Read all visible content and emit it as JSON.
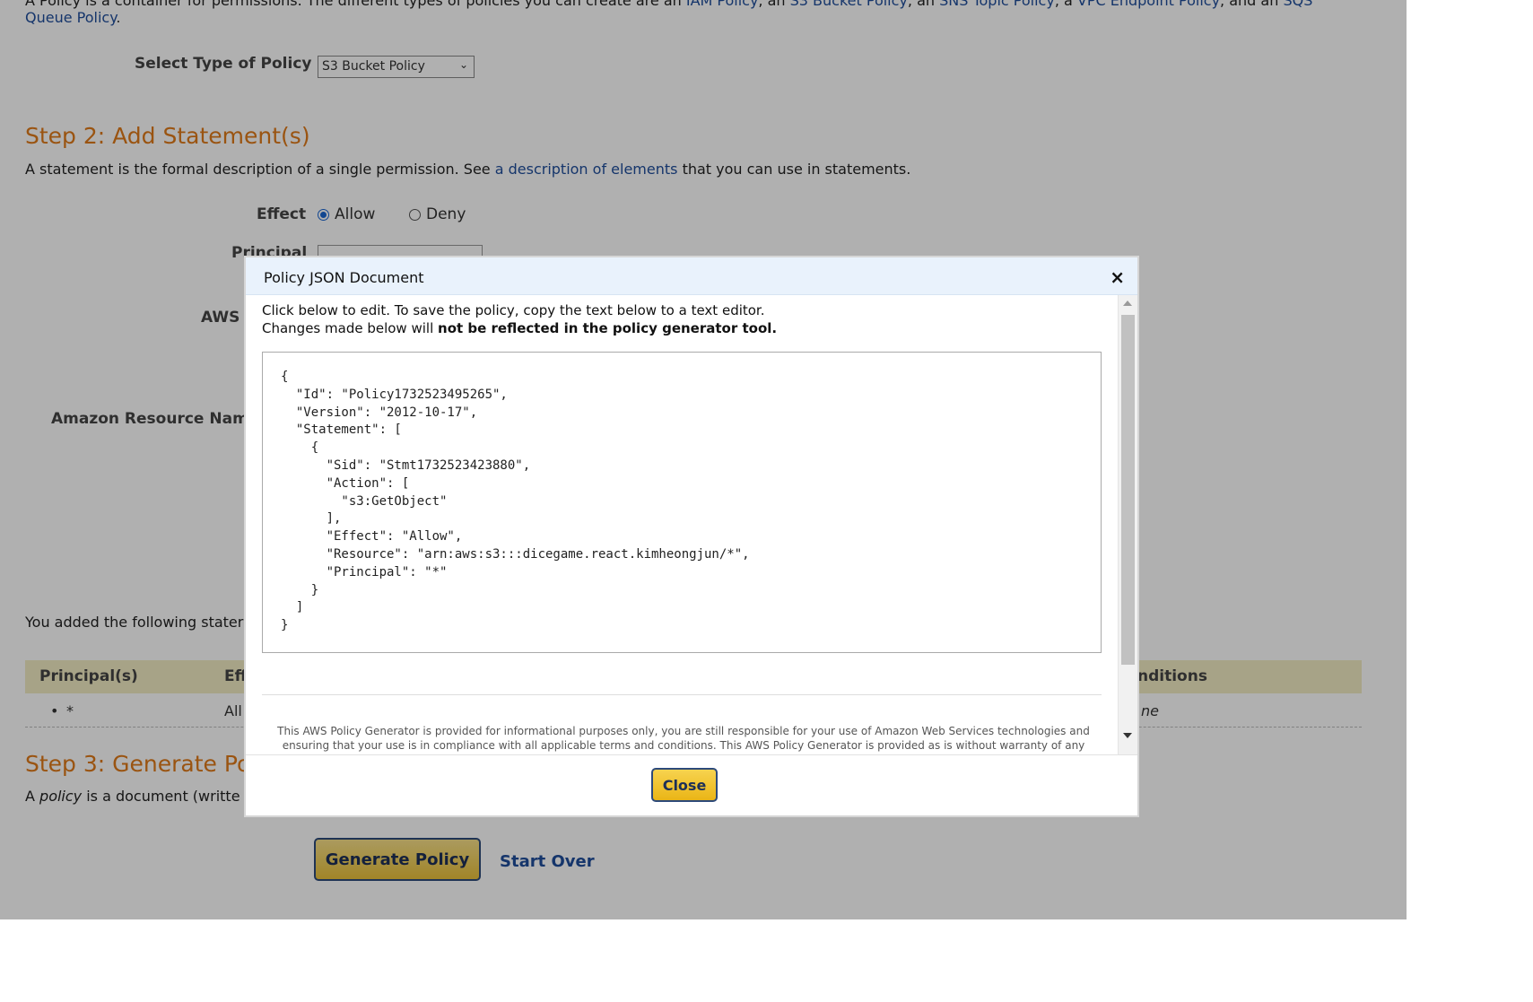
{
  "intro": {
    "prefix": "A Policy is a container for permissions. The different types of policies you can create are an ",
    "link_iam": "IAM Policy",
    "sep1": ", an ",
    "link_s3": "S3 Bucket Policy",
    "sep2": ", an ",
    "link_sns": "SNS Topic Policy",
    "sep3": ", a ",
    "link_vpc": "VPC Endpoint Policy",
    "sep4": ", and an ",
    "link_sqs": "SQS",
    "link_sqs2": "Queue Policy",
    "suffix": "."
  },
  "step1": {
    "select_label": "Select Type of Policy",
    "select_value": "S3 Bucket Policy"
  },
  "step2": {
    "heading": "Step 2: Add Statement(s)",
    "desc_prefix": "A statement is the formal description of a single permission. See ",
    "desc_link": "a description of elements",
    "desc_suffix": " that you can use in statements.",
    "effect_label": "Effect",
    "effect_allow": "Allow",
    "effect_deny": "Deny",
    "principal_label": "Principal",
    "aws_label": "AWS",
    "arn_label": "Amazon Resource Name",
    "added_text": "You added the following stater",
    "table": {
      "col_principal": "Principal(s)",
      "col_effect": "Eff",
      "col_conditions": "nditions",
      "row_principal": "*",
      "row_effect": "All",
      "row_conditions": "ne"
    }
  },
  "step3": {
    "heading": "Step 3: Generate Po",
    "desc_a": "A ",
    "desc_policy": "policy",
    "desc_rest": " is a document (writte",
    "generate_button": "Generate Policy",
    "start_over": "Start Over"
  },
  "modal": {
    "title": "Policy JSON Document",
    "close_x": "×",
    "note_line1": "Click below to edit. To save the policy, copy the text below to a text editor.",
    "note_line2_prefix": "Changes made below will ",
    "note_line2_bold": "not be reflected in the policy generator tool.",
    "json_text": "{\n  \"Id\": \"Policy1732523495265\",\n  \"Version\": \"2012-10-17\",\n  \"Statement\": [\n    {\n      \"Sid\": \"Stmt1732523423880\",\n      \"Action\": [\n        \"s3:GetObject\"\n      ],\n      \"Effect\": \"Allow\",\n      \"Resource\": \"arn:aws:s3:::dicegame.react.kimheongjun/*\",\n      \"Principal\": \"*\"\n    }\n  ]\n}",
    "disclaimer": "This AWS Policy Generator is provided for informational purposes only, you are still responsible for your use of Amazon Web Services technologies and ensuring that your use is in compliance with all applicable terms and conditions. This AWS Policy Generator is provided as is without warranty of any kind, whether",
    "close_button": "Close"
  }
}
